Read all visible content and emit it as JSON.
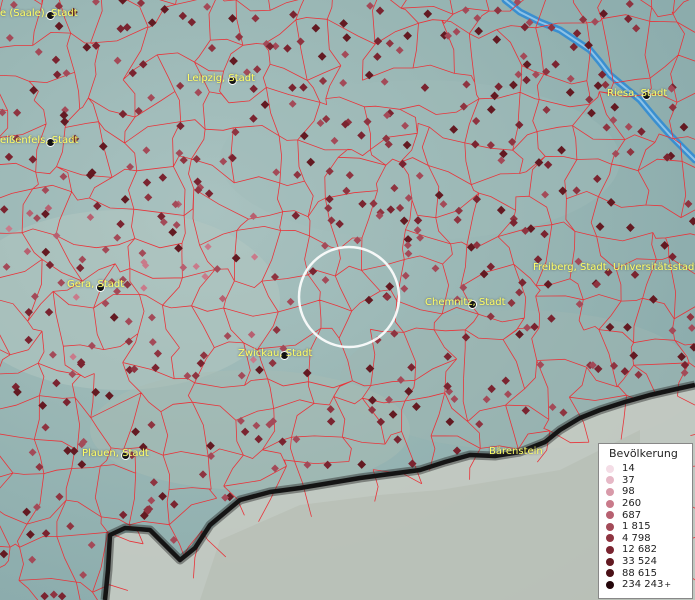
{
  "cities": [
    {
      "label": "e (Saale), Stadt"
    },
    {
      "label": "Leipzig, Stadt"
    },
    {
      "label": "Riesa, Stadt"
    },
    {
      "label": "eißenfels, Stadt"
    },
    {
      "label": "Gera, Stadt"
    },
    {
      "label": "Chemnitz, Stadt"
    },
    {
      "label": "Freiberg, Stadt, Universitätsstadt"
    },
    {
      "label": "Zwickau, Stadt"
    },
    {
      "label": "Plauen, Stadt"
    },
    {
      "label": "Bärenstein"
    }
  ],
  "legend": {
    "title": "Bevölkerung",
    "classes": [
      {
        "value": "14",
        "color": "#f4dde6"
      },
      {
        "value": "37",
        "color": "#e6b8c6"
      },
      {
        "value": "98",
        "color": "#d89aa9"
      },
      {
        "value": "260",
        "color": "#c97a8a"
      },
      {
        "value": "687",
        "color": "#b76070"
      },
      {
        "value": "1 815",
        "color": "#a34a58"
      },
      {
        "value": "4 798",
        "color": "#8e3440"
      },
      {
        "value": "12 682",
        "color": "#7a2430"
      },
      {
        "value": "33 524",
        "color": "#631a22"
      },
      {
        "value": "88 615",
        "color": "#4a1016"
      },
      {
        "value": "234 243",
        "color": "#24060a"
      }
    ],
    "plus": "+"
  },
  "colors": {
    "boundary": "#e8343a",
    "river": "#3a8fd0",
    "border": "#141414",
    "highlight_circle": "#ffffff",
    "city_label": "#ffff66"
  }
}
